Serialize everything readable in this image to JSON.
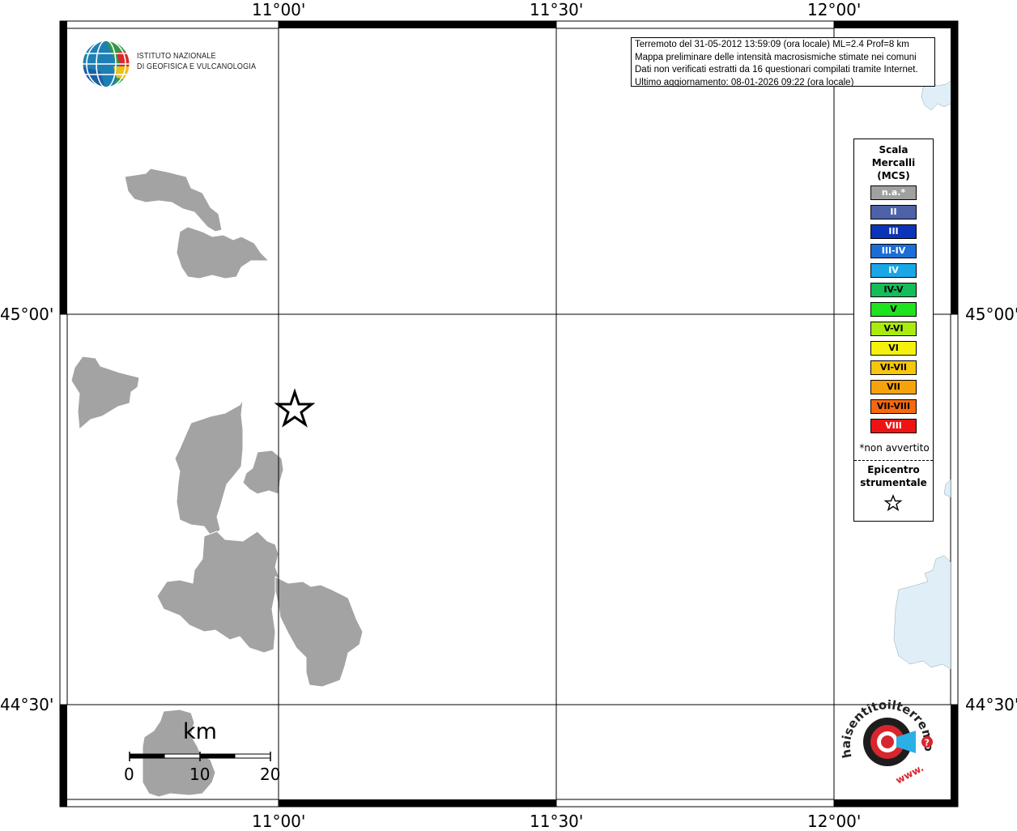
{
  "map": {
    "lon_labels": [
      "11°00'",
      "11°30'",
      "12°00'"
    ],
    "lat_labels": [
      "45°00'",
      "44°30'"
    ]
  },
  "info": {
    "line1": "Terremoto del 31-05-2012 13:59:09 (ora locale) ML=2.4 Prof=8 km",
    "line2": "Mappa preliminare delle intensità macrosismiche stimate nei comuni",
    "line3": "Dati non verificati estratti da 16 questionari compilati tramite Internet.",
    "line4": "Ultimo aggiornamento: 08-01-2026 09:22 (ora locale)"
  },
  "logo": {
    "institute": "ISTITUTO NAZIONALE\nDI GEOFISICA E VULCANOLOGIA"
  },
  "legend": {
    "title": "Scala\nMercalli\n(MCS)",
    "items": [
      {
        "label": "n.a.*",
        "color": "#a0a0a0",
        "text_color": "#ffffff"
      },
      {
        "label": "II",
        "color": "#4d62a9",
        "text_color": "#ffffff"
      },
      {
        "label": "III",
        "color": "#0b34b8",
        "text_color": "#ffffff"
      },
      {
        "label": "III-IV",
        "color": "#1a6ed6",
        "text_color": "#ffffff"
      },
      {
        "label": "IV",
        "color": "#1aa7e8",
        "text_color": "#ffffff"
      },
      {
        "label": "IV-V",
        "color": "#14bc5a",
        "text_color": "#000000"
      },
      {
        "label": "V",
        "color": "#1ee31e",
        "text_color": "#000000"
      },
      {
        "label": "V-VI",
        "color": "#aaea0e",
        "text_color": "#000000"
      },
      {
        "label": "VI",
        "color": "#f4f10b",
        "text_color": "#000000"
      },
      {
        "label": "VI-VII",
        "color": "#f5c60c",
        "text_color": "#000000"
      },
      {
        "label": "VII",
        "color": "#f7a20c",
        "text_color": "#000000"
      },
      {
        "label": "VII-VIII",
        "color": "#f46a0f",
        "text_color": "#000000"
      },
      {
        "label": "VIII",
        "color": "#ee1313",
        "text_color": "#ffffff"
      }
    ],
    "note": "*non avvertito",
    "epicenter_label": "Epicentro\nstrumentale",
    "epicenter_symbol": "☆"
  },
  "scale_bar": {
    "unit": "km",
    "ticks": [
      "0",
      "10",
      "20"
    ]
  },
  "hsit_logo": {
    "text": "haisentitoilterremoto.it",
    "prefix": "www."
  },
  "colors": {
    "municipality": "#a3a3a3",
    "water": "#e0eef7",
    "grid": "#000000"
  }
}
